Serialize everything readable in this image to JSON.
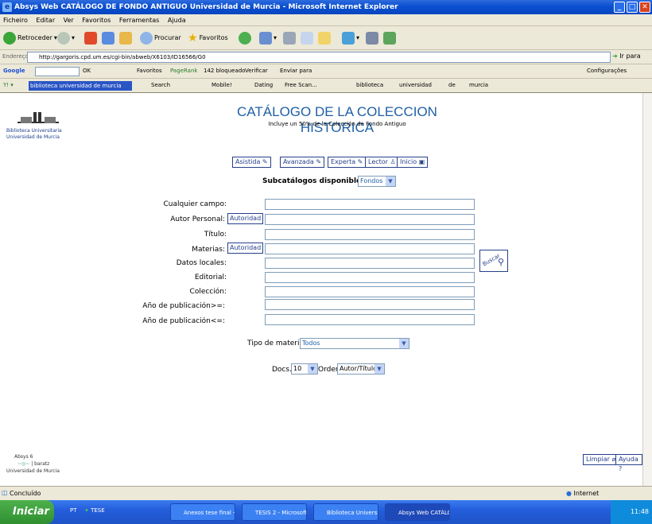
{
  "window": {
    "title": "Absys Web  CATÁLOGO DE FONDO ANTIGUO Universidad de Murcia - Microsoft Internet Explorer"
  },
  "menu": [
    "Ficheiro",
    "Editar",
    "Ver",
    "Favoritos",
    "Ferramentas",
    "Ajuda"
  ],
  "toolbar": {
    "back": "Retroceder",
    "search": "Procurar",
    "favorites": "Favoritos"
  },
  "address": {
    "label": "Endereço",
    "url": "http://gargoris.cpd.um.es/cgi-bin/abweb/X6103/ID16566/G0",
    "go": "Ir para",
    "links": "Hiperligações"
  },
  "googlebar": {
    "logo": "Google",
    "ok": "OK",
    "favoritos": "Favoritos",
    "pagerank": "PageRank",
    "blocked": "142 bloqueado",
    "verify": "Verificar",
    "send": "Enviar para",
    "settings": "Configurações"
  },
  "linksbar": {
    "query": "biblioteca universidad de murcia",
    "search": "Search",
    "mobile": "Mobile!",
    "dating": "Dating",
    "freescan": "Free Scan...",
    "terms": [
      "biblioteca",
      "universidad",
      "de",
      "murcia"
    ]
  },
  "page": {
    "logo_line1": "Biblioteca Universitaria",
    "logo_line2": "Universidad de Murcia",
    "title": "CATÁLOGO DE LA COLECCION HISTORICA",
    "subtitle": "Incluye un 50% de la Colección de Fondo Antiguo",
    "modes": [
      "Asistida",
      "Avanzada",
      "Experta",
      "Lector",
      "Inicio"
    ],
    "subcat_label": "Subcatálogos disponibles:",
    "subcat_value": "Fondos",
    "fields": [
      "Cualquier campo:",
      "Autor Personal:",
      "Título:",
      "Materias:",
      "Datos locales:",
      "Editorial:",
      "Colección:",
      "Año de publicación>=:",
      "Año de publicación<=:"
    ],
    "authority": "Autoridad",
    "search_button": "Buscar",
    "material_label": "Tipo de material",
    "material_value": "Todos",
    "docs_label": "Docs.",
    "docs_value": "10",
    "order_label": "Orden",
    "order_value": "Autor/Título",
    "footer_line1": "Absys 6",
    "footer_line2": "baratz",
    "footer_line3": "Universidad de Murcia",
    "clear_button": "Limpiar",
    "help_button": "Ayuda"
  },
  "status": {
    "text": "Concluído",
    "zone": "Internet"
  },
  "taskbar": {
    "start": "Iniciar",
    "lang": "PT",
    "tese": "TESE",
    "tasks": [
      "Anexos tese final - Mi...",
      "TESIS 2 - Microsoft W...",
      "Biblioteca Universitari...",
      "Absys Web  CATÁLO..."
    ],
    "clock": "11:48"
  }
}
